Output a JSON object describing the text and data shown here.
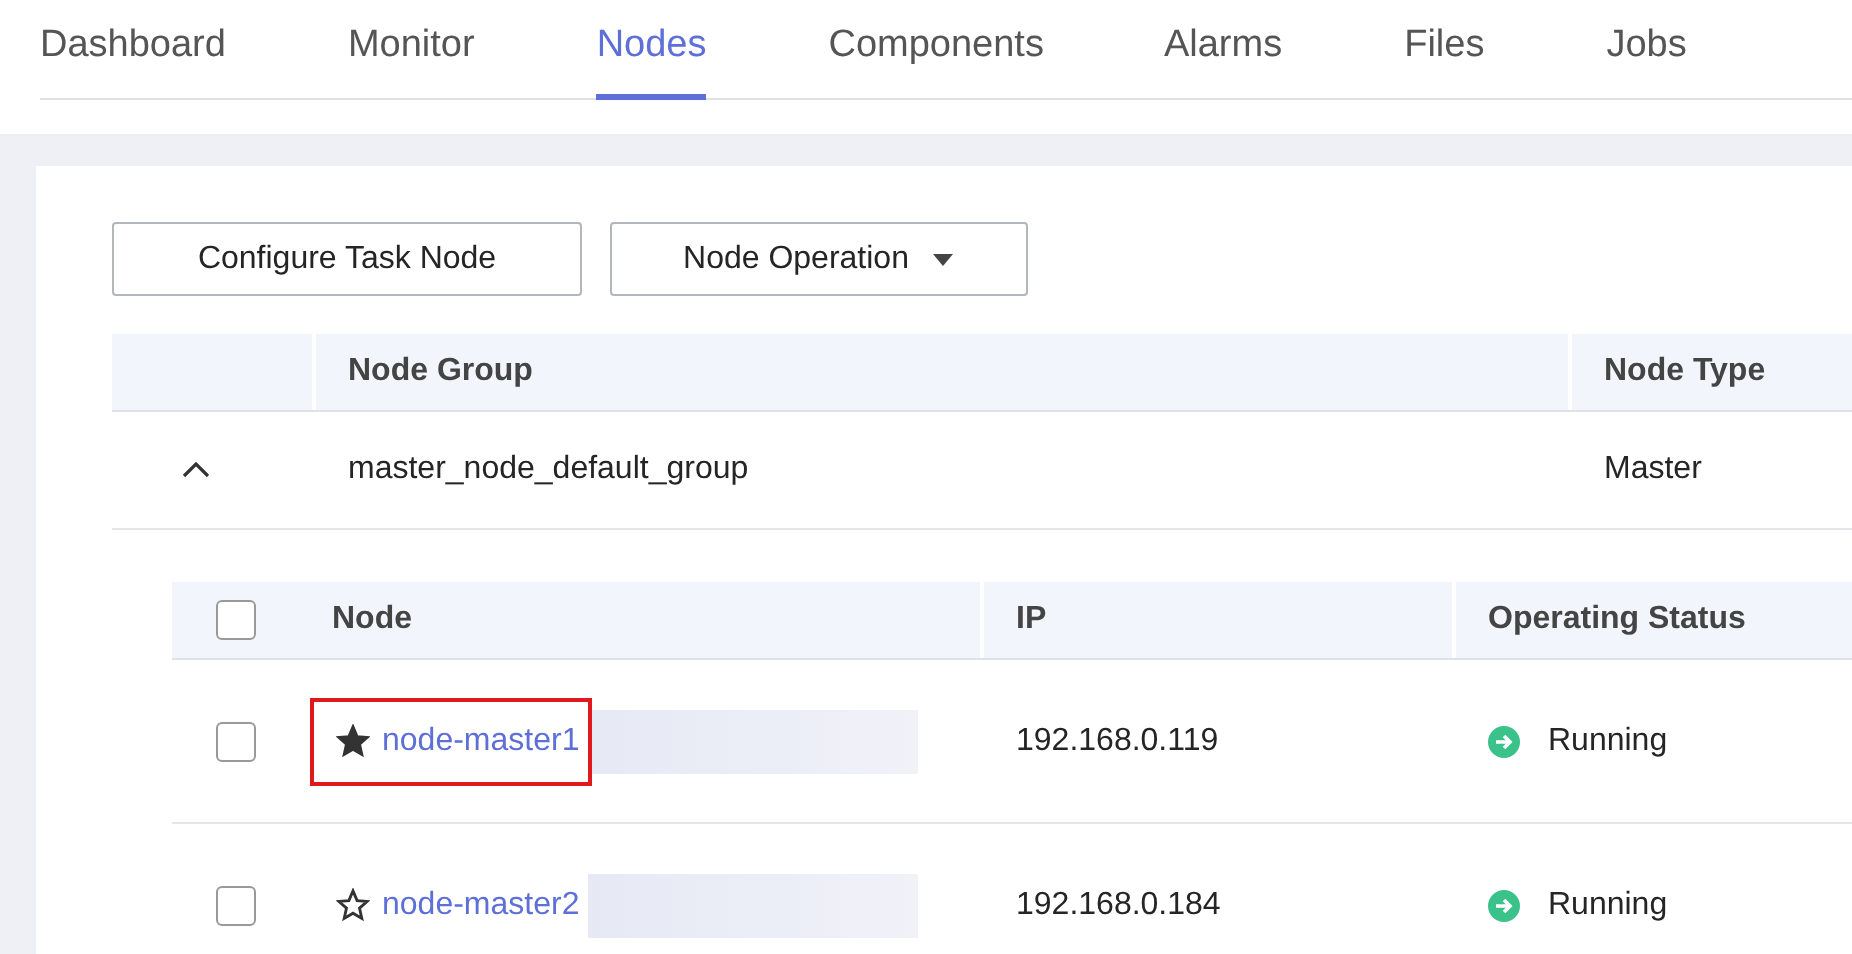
{
  "tabs": [
    {
      "label": "Dashboard",
      "selected": false
    },
    {
      "label": "Monitor",
      "selected": false
    },
    {
      "label": "Nodes",
      "selected": true
    },
    {
      "label": "Components",
      "selected": false
    },
    {
      "label": "Alarms",
      "selected": false
    },
    {
      "label": "Files",
      "selected": false
    },
    {
      "label": "Jobs",
      "selected": false
    }
  ],
  "buttons": [
    {
      "label": "Configure Task Node",
      "kind": "plain"
    },
    {
      "label": "Node Operation",
      "kind": "dropdown"
    }
  ],
  "group_table": {
    "columns": [
      "Node Group",
      "Node Type"
    ],
    "rows": [
      {
        "expanded": true,
        "node_group": "master_node_default_group",
        "node_type": "Master"
      }
    ]
  },
  "node_table": {
    "columns": [
      "Node",
      "IP",
      "Operating Status"
    ],
    "header_checked": false,
    "rows": [
      {
        "checked": false,
        "starred": true,
        "node": "node-master1",
        "highlighted": true,
        "redacted": true,
        "ip": "192.168.0.119",
        "status": "Running"
      },
      {
        "checked": false,
        "starred": false,
        "node": "node-master2",
        "highlighted": false,
        "redacted": true,
        "ip": "192.168.0.184",
        "status": "Running"
      }
    ]
  }
}
